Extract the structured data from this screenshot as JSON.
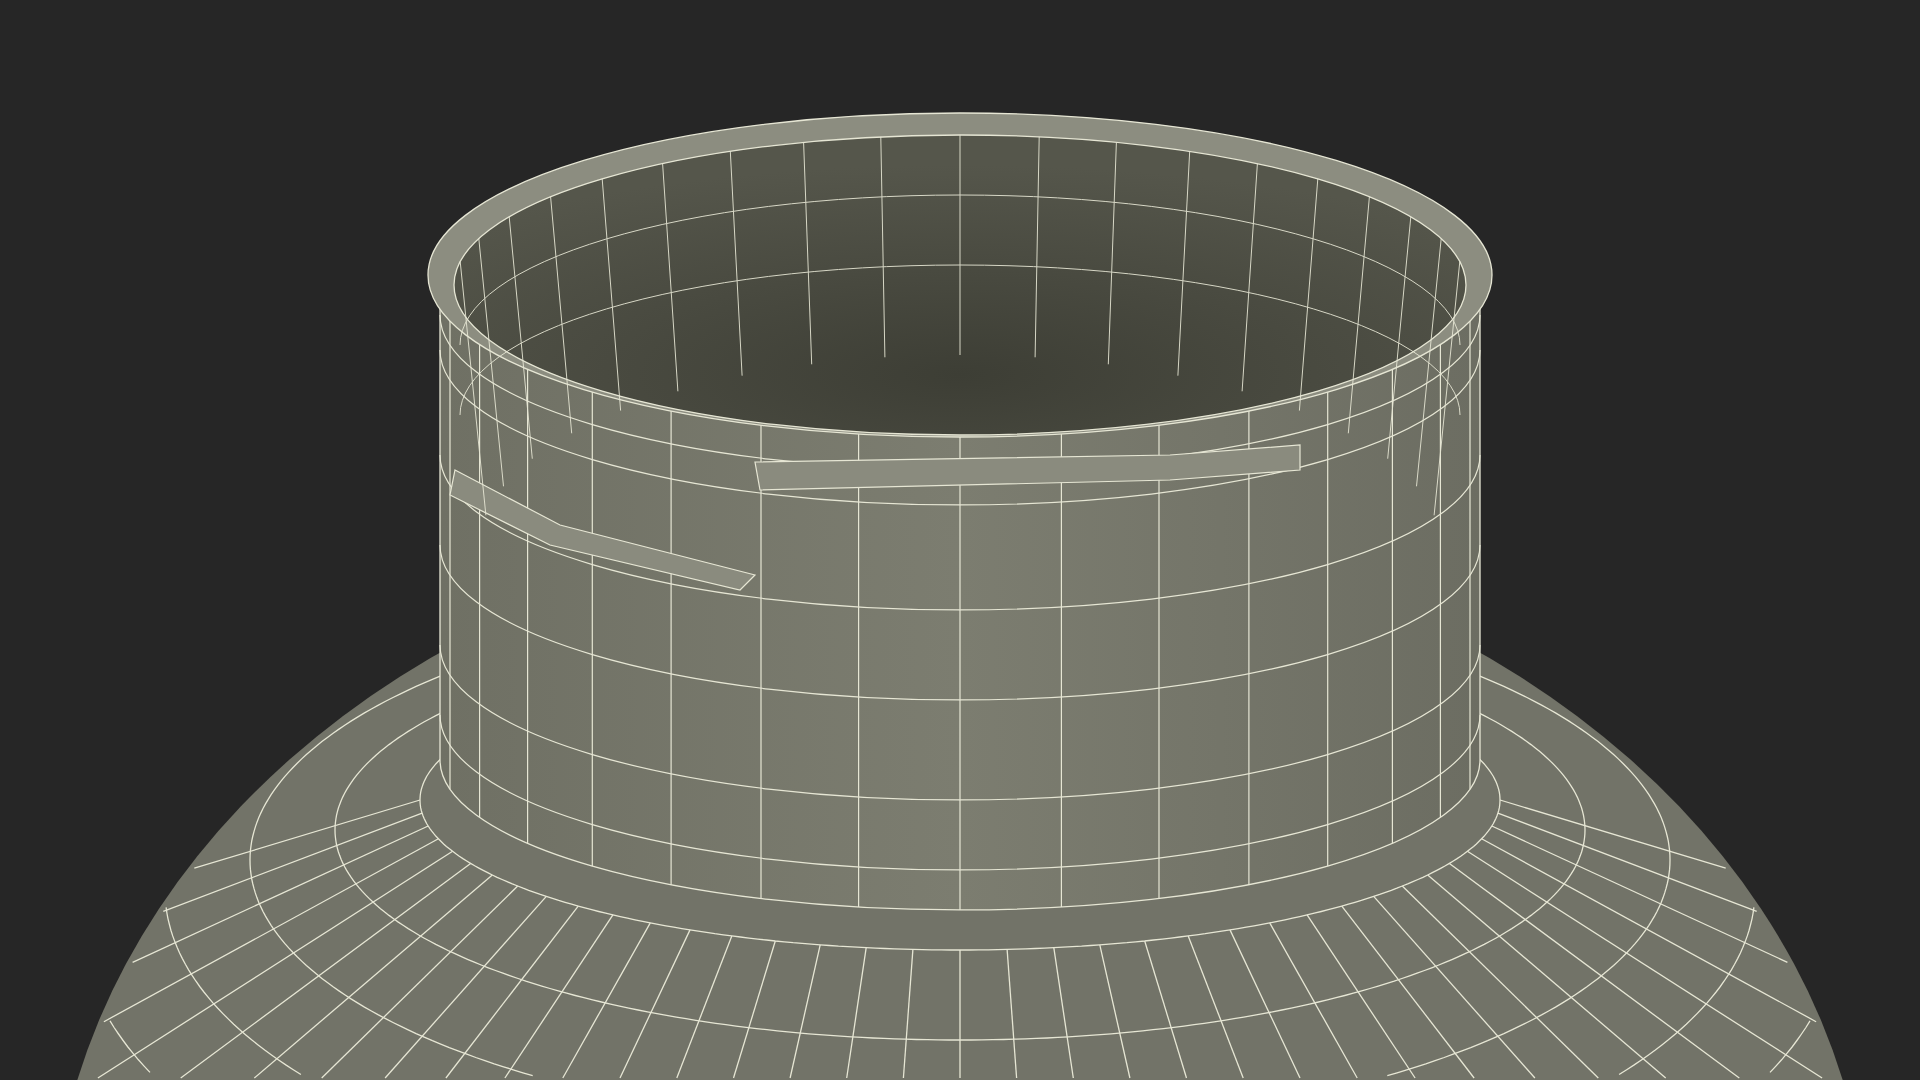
{
  "scene": {
    "kind": "wireframe-render"
  }
}
